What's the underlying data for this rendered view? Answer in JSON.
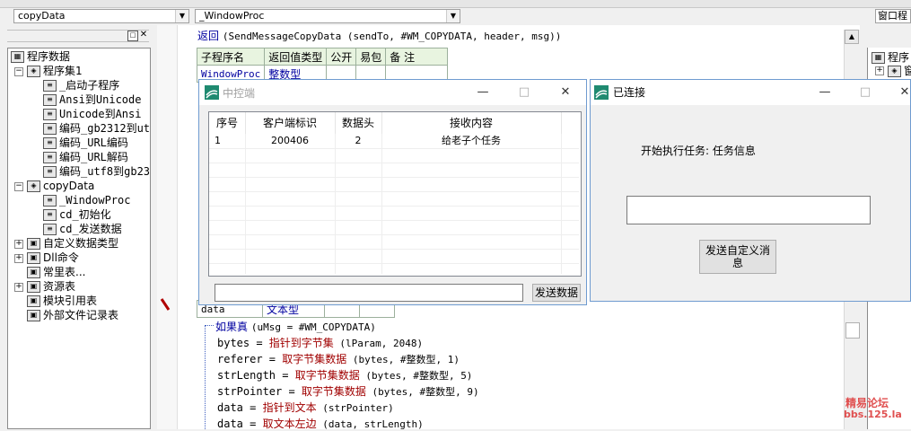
{
  "toolbar": {
    "module_combo": "copyData",
    "proc_combo": "_WindowProc",
    "right_tab": "窗口程"
  },
  "tree": {
    "root": "程序数据",
    "group1": "程序集1",
    "group1_items": [
      "_启动子程序",
      "Ansi到Unicode",
      "Unicode到Ansi",
      "编码_gb2312到ut",
      "编码_URL编码",
      "编码_URL解码",
      "编码_utf8到gb23"
    ],
    "group2": "copyData",
    "group2_items": [
      "_WindowProc",
      "cd_初始化",
      "cd_发送数据"
    ],
    "others": [
      "自定义数据类型",
      "Dll命令",
      "常里表...",
      "资源表",
      "模块引用表",
      "外部文件记录表"
    ]
  },
  "right_panel": {
    "root": "程序",
    "child": "窗"
  },
  "code": {
    "first_line_kw": "返回",
    "first_line_rest": "(SendMessageCopyData (sendTo, #WM_COPYDATA, header, msg))",
    "table_headers": [
      "子程序名",
      "返回值类型",
      "公开",
      "易包",
      "备 注"
    ],
    "table_row": [
      "WindowProc",
      "整数型"
    ],
    "param_row": [
      "data",
      "文本型"
    ],
    "lines": [
      {
        "pre": "如果真 ",
        "fn": "",
        "rest": "(uMsg = #WM_COPYDATA)"
      },
      {
        "pre": "bytes = ",
        "fn": "指针到字节集",
        "rest": " (lParam, 2048)"
      },
      {
        "pre": "referer = ",
        "fn": "取字节集数据",
        "rest": " (bytes, #整数型, 1)"
      },
      {
        "pre": "strLength = ",
        "fn": "取字节集数据",
        "rest": " (bytes, #整数型, 5)"
      },
      {
        "pre": "strPointer = ",
        "fn": "取字节集数据",
        "rest": " (bytes, #整数型, 9)"
      },
      {
        "pre": "data = ",
        "fn": "指针到文本",
        "rest": " (strPointer)"
      },
      {
        "pre": "data = ",
        "fn": "取文本左边",
        "rest": " (data, strLength)"
      }
    ]
  },
  "server_window": {
    "title": "中控端",
    "columns": [
      "序号",
      "客户端标识",
      "数据头",
      "接收内容"
    ],
    "rows": [
      {
        "id": "1",
        "client": "200406",
        "head": "2",
        "content": "给老子个任务"
      }
    ],
    "send_button": "发送数据",
    "input_value": ""
  },
  "client_window": {
    "title": "已连接",
    "status_text": "开始执行任务: 任务信息",
    "input_value": "",
    "send_button": "发送自定义消息"
  },
  "watermark": {
    "line1": "精易论坛",
    "line2": "bbs.125.la"
  }
}
